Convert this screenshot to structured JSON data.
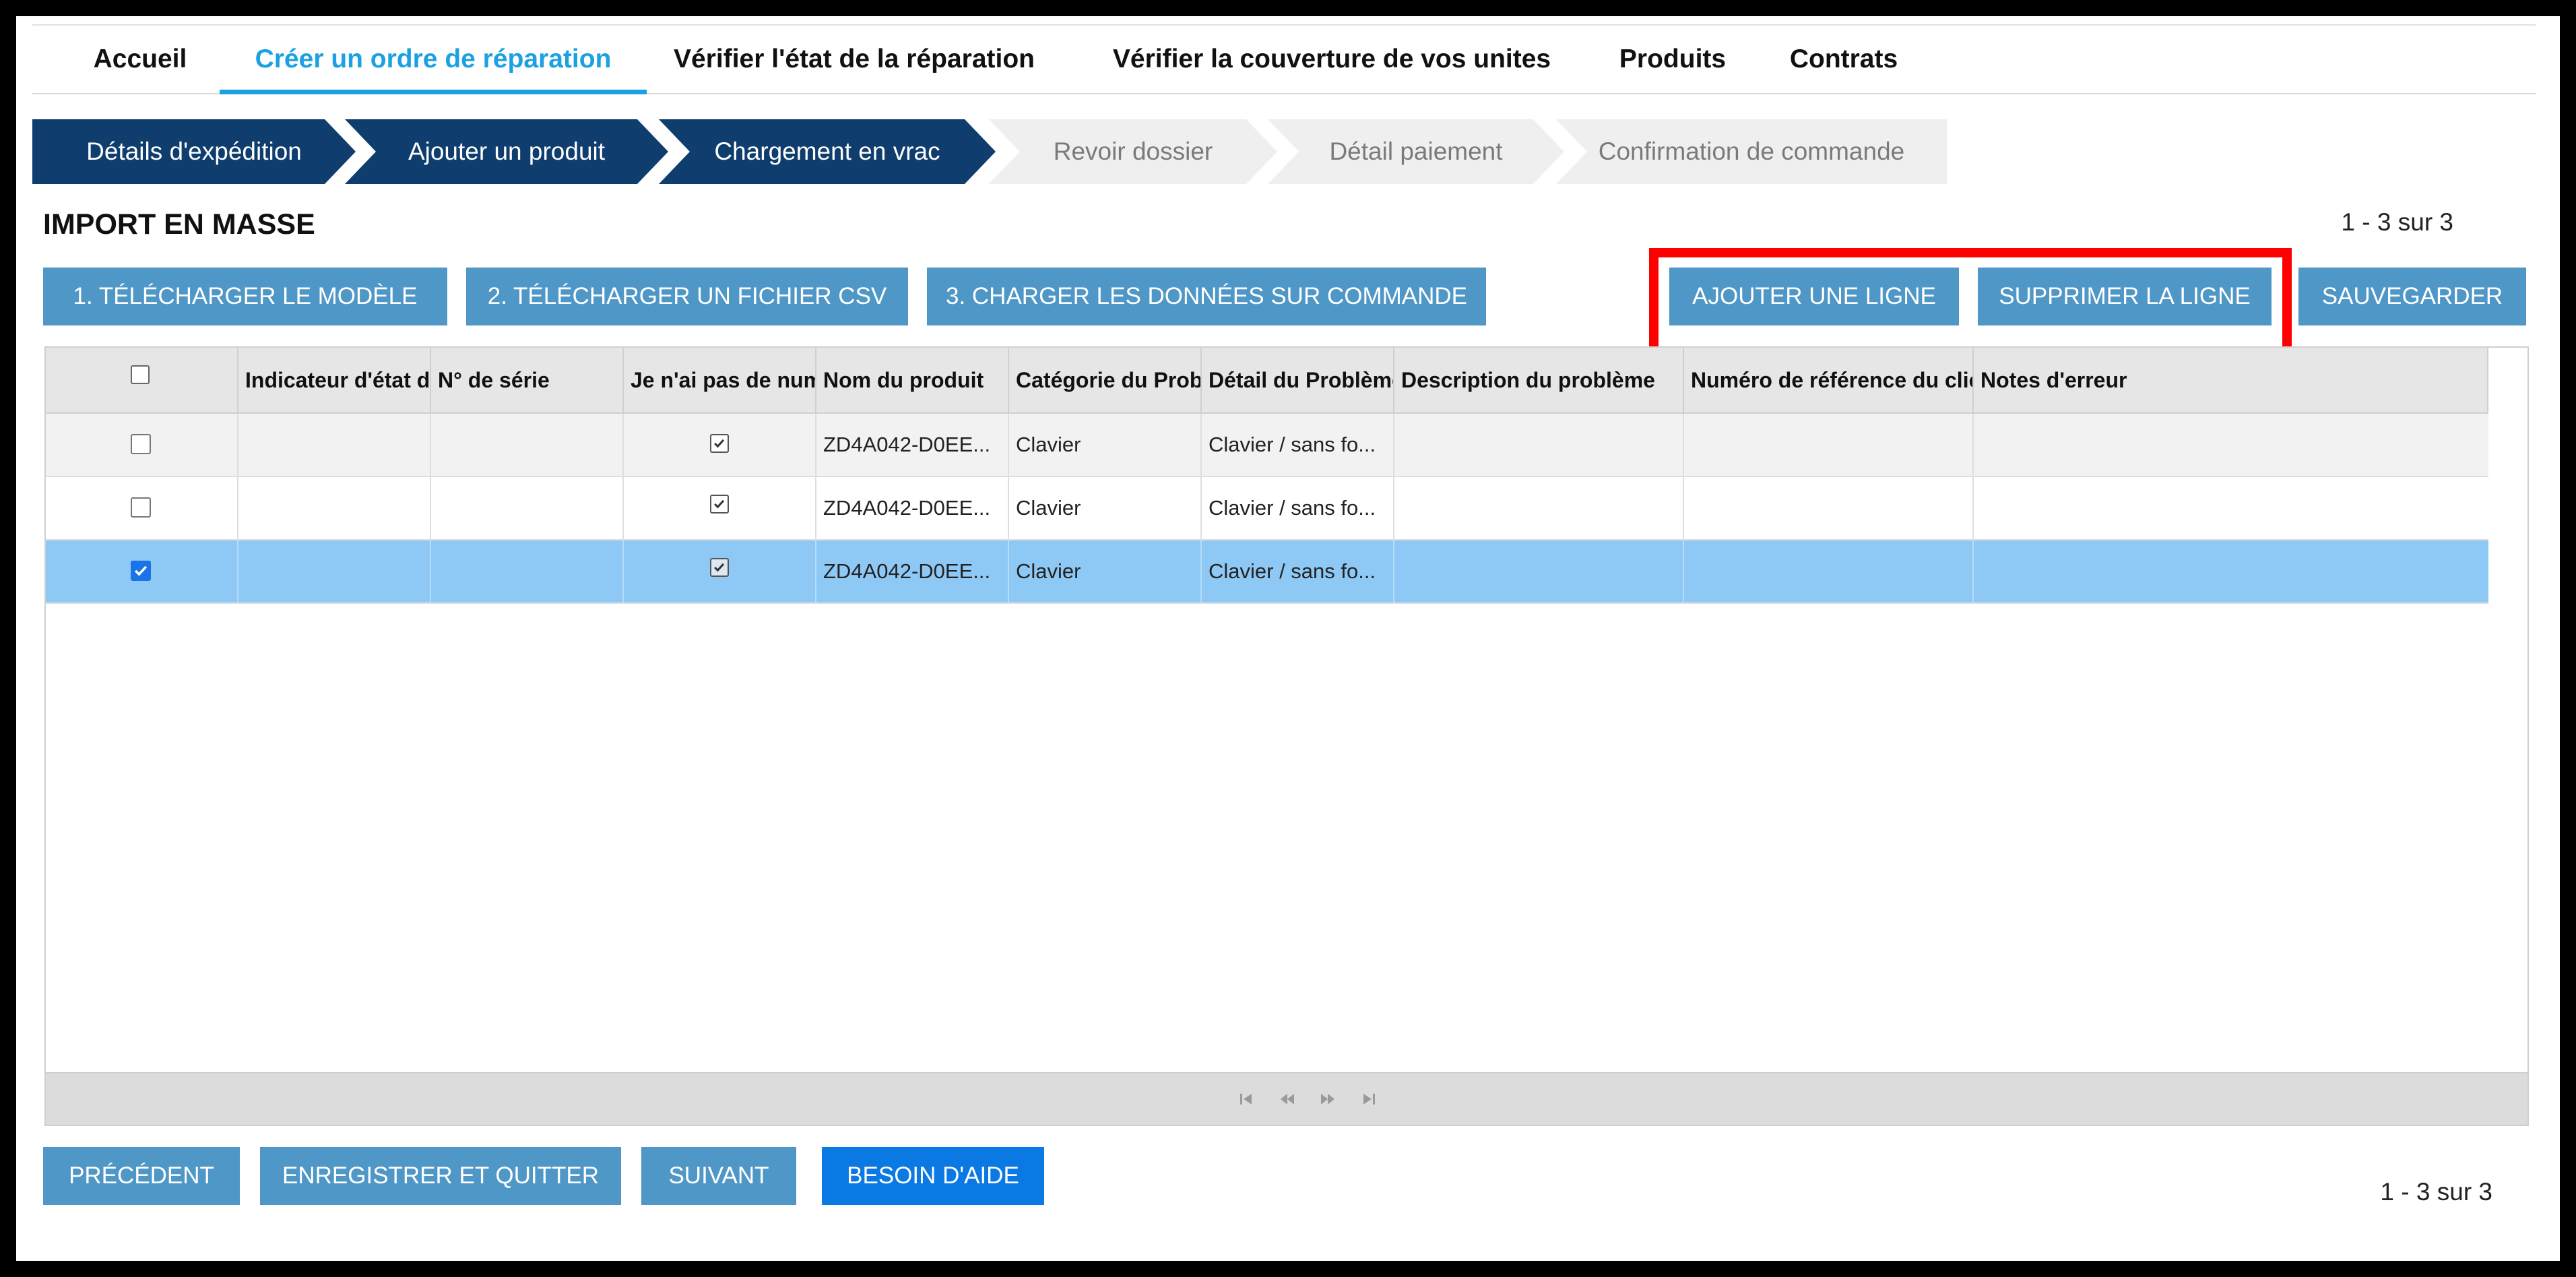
{
  "nav": {
    "items": [
      {
        "label": "Accueil"
      },
      {
        "label": "Créer un ordre de réparation"
      },
      {
        "label": "Vérifier l'état de la réparation"
      },
      {
        "label": "Vérifier la couverture de vos unites"
      },
      {
        "label": "Produits"
      },
      {
        "label": "Contrats"
      }
    ],
    "active_index": 1
  },
  "steps": [
    {
      "label": "Détails d'expédition",
      "state": "done"
    },
    {
      "label": "Ajouter un produit",
      "state": "done"
    },
    {
      "label": "Chargement en vrac",
      "state": "done"
    },
    {
      "label": "Revoir dossier",
      "state": "todo"
    },
    {
      "label": "Détail paiement",
      "state": "todo"
    },
    {
      "label": "Confirmation de commande",
      "state": "todo"
    }
  ],
  "section": {
    "title": "IMPORT EN MASSE",
    "pager_text": "1 - 3 sur 3"
  },
  "toolbar": {
    "download_template": "1. TÉLÉCHARGER LE MODÈLE",
    "upload_csv": "2. TÉLÉCHARGER UN FICHIER CSV",
    "load_data": "3. CHARGER LES DONNÉES SUR COMMANDE",
    "add_row": "AJOUTER UNE LIGNE",
    "delete_row": "SUPPRIMER LA LIGNE",
    "save": "SAUVEGARDER"
  },
  "grid": {
    "columns": [
      "",
      "Indicateur d'état de",
      "N° de série",
      "Je n'ai pas de num",
      "Nom du produit",
      "Catégorie du Prob",
      "Détail du Problème",
      "Description du problème",
      "Numéro de référence du clie",
      "Notes d'erreur"
    ],
    "rows": [
      {
        "selected": false,
        "status": "",
        "serial": "",
        "no_serial": true,
        "product": "ZD4A042-D0EE...",
        "category": "Clavier",
        "detail": "Clavier / sans fo...",
        "description": "",
        "reference": "",
        "notes": ""
      },
      {
        "selected": false,
        "status": "",
        "serial": "",
        "no_serial": true,
        "product": "ZD4A042-D0EE...",
        "category": "Clavier",
        "detail": "Clavier / sans fo...",
        "description": "",
        "reference": "",
        "notes": ""
      },
      {
        "selected": true,
        "status": "",
        "serial": "",
        "no_serial": true,
        "product": "ZD4A042-D0EE...",
        "category": "Clavier",
        "detail": "Clavier / sans fo...",
        "description": "",
        "reference": "",
        "notes": ""
      }
    ]
  },
  "footer": {
    "previous": "PRÉCÉDENT",
    "save_quit": "ENREGISTRER ET QUITTER",
    "next": "SUIVANT",
    "help": "BESOIN D'AIDE",
    "pager_text": "1 - 3 sur 3"
  },
  "colors": {
    "active_nav": "#1ba1e2",
    "step_done": "#0e3d6e",
    "button": "#4e97c7",
    "help_button": "#0a79e3",
    "selected_row": "#8ec9f6",
    "highlight": "#ff0000"
  },
  "icons": [
    "checkbox-icon",
    "first-page-icon",
    "prev-page-icon",
    "next-page-icon",
    "last-page-icon"
  ]
}
